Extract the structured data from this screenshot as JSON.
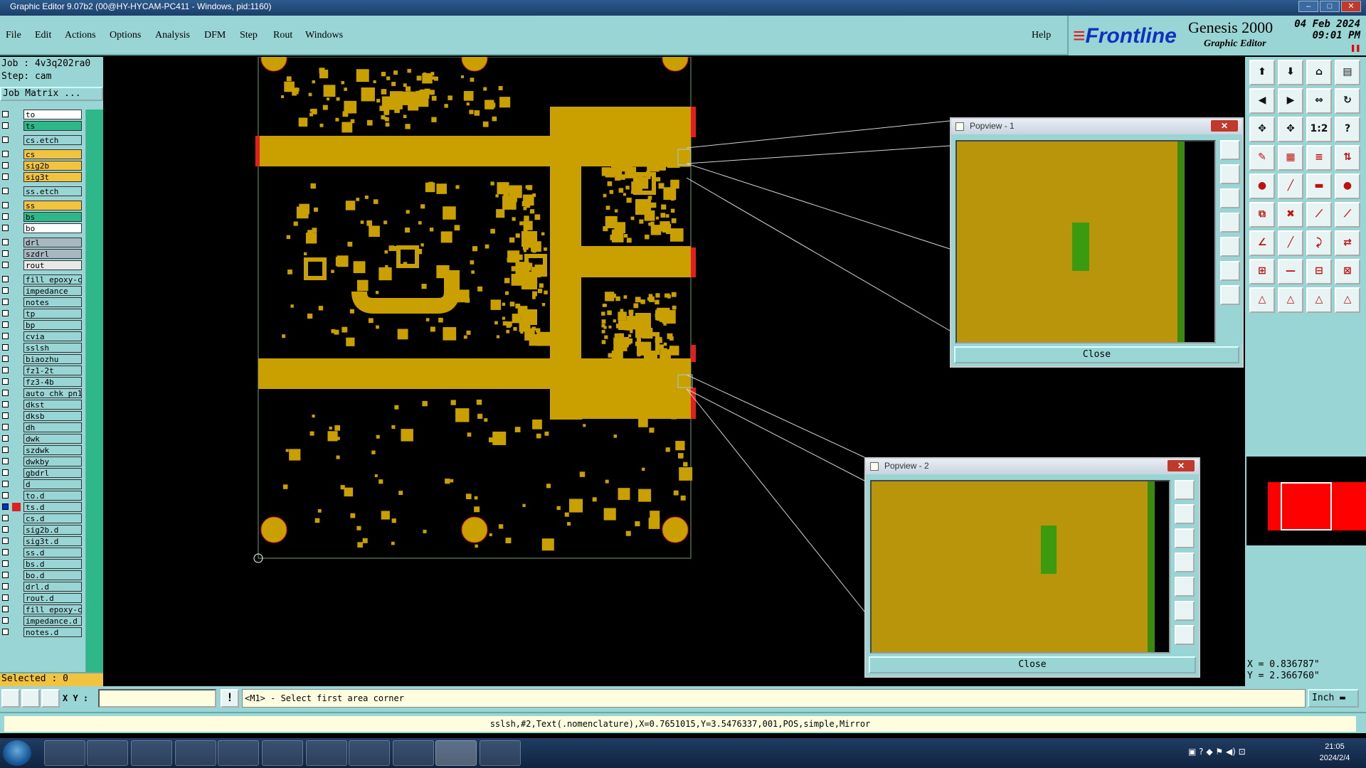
{
  "window": {
    "title": "Graphic Editor 9.07b2 (00@HY-HYCAM-PC411 - Windows, pid:1160)"
  },
  "menu": {
    "items": [
      "File",
      "Edit",
      "Actions",
      "Options",
      "Analysis",
      "DFM",
      "Step",
      "Rout",
      "Windows"
    ],
    "help": "Help"
  },
  "brand": {
    "logo": "Frontline",
    "product": "Genesis 2000",
    "subtitle": "Graphic Editor",
    "date": "04 Feb 2024",
    "time": "09:01 PM"
  },
  "job": {
    "job": "Job : 4v3q202ra0",
    "step": "Step: cam",
    "matrix_button": "Job Matrix ..."
  },
  "layers": [
    {
      "name": "to",
      "color": "#ffffff",
      "mark": "none"
    },
    {
      "name": "ts",
      "color": "#2eb88a",
      "mark": "none"
    },
    {
      "name": "cs.etch",
      "color": "#9ad5d5",
      "mark": "none"
    },
    {
      "name": "cs",
      "color": "#f2c340",
      "mark": "none"
    },
    {
      "name": "sig2b",
      "color": "#f2c340",
      "mark": "none"
    },
    {
      "name": "sig3t",
      "color": "#f2c340",
      "mark": "none"
    },
    {
      "name": "ss.etch",
      "color": "#9ad5d5",
      "mark": "none"
    },
    {
      "name": "ss",
      "color": "#f2c340",
      "mark": "none"
    },
    {
      "name": "bs",
      "color": "#2eb88a",
      "mark": "none"
    },
    {
      "name": "bo",
      "color": "#ffffff",
      "mark": "none"
    },
    {
      "name": "drl",
      "color": "#a8b8c0",
      "mark": "none"
    },
    {
      "name": "szdrl",
      "color": "#a8b8c0",
      "mark": "none"
    },
    {
      "name": "rout",
      "color": "#e8e8e8",
      "mark": "none"
    },
    {
      "name": "fill_epoxy-c",
      "color": "#9ad5d5",
      "mark": "none"
    },
    {
      "name": "impedance",
      "color": "#9ad5d5",
      "mark": "none"
    },
    {
      "name": "notes",
      "color": "#9ad5d5",
      "mark": "none"
    },
    {
      "name": "tp",
      "color": "#9ad5d5",
      "mark": "none"
    },
    {
      "name": "bp",
      "color": "#9ad5d5",
      "mark": "none"
    },
    {
      "name": "cvia",
      "color": "#9ad5d5",
      "mark": "none"
    },
    {
      "name": "sslsh",
      "color": "#9ad5d5",
      "mark": "none"
    },
    {
      "name": "biaozhu",
      "color": "#9ad5d5",
      "mark": "none"
    },
    {
      "name": "fz1-2t",
      "color": "#9ad5d5",
      "mark": "none"
    },
    {
      "name": "fz3-4b",
      "color": "#9ad5d5",
      "mark": "none"
    },
    {
      "name": "auto_chk_pn1",
      "color": "#9ad5d5",
      "mark": "none"
    },
    {
      "name": "dkst",
      "color": "#9ad5d5",
      "mark": "none"
    },
    {
      "name": "dksb",
      "color": "#9ad5d5",
      "mark": "none"
    },
    {
      "name": "dh",
      "color": "#9ad5d5",
      "mark": "none"
    },
    {
      "name": "dwk",
      "color": "#9ad5d5",
      "mark": "none"
    },
    {
      "name": "szdwk",
      "color": "#9ad5d5",
      "mark": "none"
    },
    {
      "name": "dwkby",
      "color": "#9ad5d5",
      "mark": "none"
    },
    {
      "name": "gbdrl",
      "color": "#9ad5d5",
      "mark": "none"
    },
    {
      "name": "d",
      "color": "#9ad5d5",
      "mark": "none"
    },
    {
      "name": "to.d",
      "color": "#9ad5d5",
      "mark": "none"
    },
    {
      "name": "ts.d",
      "color": "#9ad5d5",
      "mark": "active"
    },
    {
      "name": "cs.d",
      "color": "#9ad5d5",
      "mark": "none"
    },
    {
      "name": "sig2b.d",
      "color": "#9ad5d5",
      "mark": "none"
    },
    {
      "name": "sig3t.d",
      "color": "#9ad5d5",
      "mark": "none"
    },
    {
      "name": "ss.d",
      "color": "#9ad5d5",
      "mark": "none"
    },
    {
      "name": "bs.d",
      "color": "#9ad5d5",
      "mark": "none"
    },
    {
      "name": "bo.d",
      "color": "#9ad5d5",
      "mark": "none"
    },
    {
      "name": "drl.d",
      "color": "#9ad5d5",
      "mark": "none"
    },
    {
      "name": "rout.d",
      "color": "#9ad5d5",
      "mark": "none"
    },
    {
      "name": "fill_epoxy-c",
      "color": "#9ad5d5",
      "mark": "none"
    },
    {
      "name": "impedance.d",
      "color": "#9ad5d5",
      "mark": "none"
    },
    {
      "name": "notes.d",
      "color": "#9ad5d5",
      "mark": "none"
    }
  ],
  "selected": "Selected : 0",
  "popview1": {
    "title": "Popview - 1",
    "close_label": "Close"
  },
  "popview2": {
    "title": "Popview - 2",
    "close_label": "Close"
  },
  "coords": {
    "x": "X = 0.836787\"",
    "y": "Y = 2.366760\""
  },
  "command": {
    "xy_label": "X Y :",
    "xy_value": "",
    "prompt": "<M1> - Select first area corner",
    "unit": "Inch"
  },
  "status": "sslsh,#2,Text(.nomenclature),X=0.7651015,Y=3.5476337,001,POS,simple,Mirror",
  "taskbar": {
    "time": "21:05",
    "date": "2024/2/4"
  },
  "colors": {
    "panel": "#9ad5d5",
    "copper": "#c9a000",
    "highlight": "#f2c340",
    "keepout": "#e02020",
    "canvas": "#000000"
  }
}
